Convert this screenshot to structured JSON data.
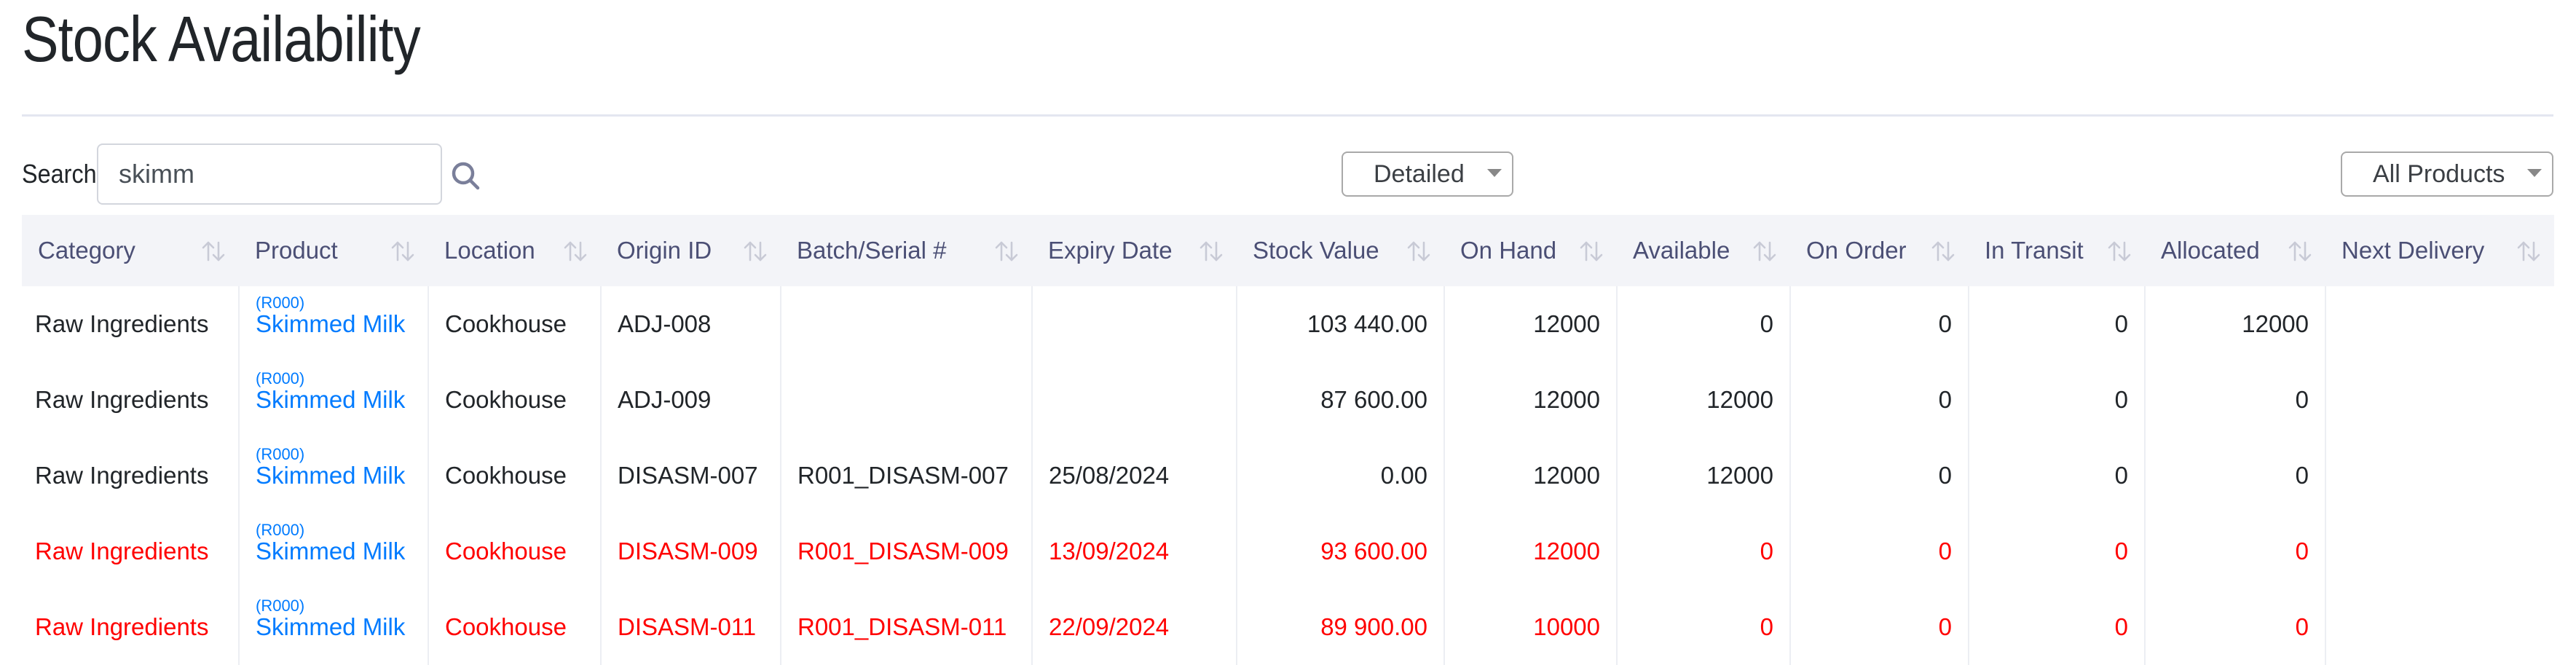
{
  "page": {
    "title": "Stock Availability"
  },
  "toolbar": {
    "search_label": "Search:",
    "search_value": "skimm",
    "search_icon": "search-icon",
    "view_select": {
      "selected": "Detailed"
    },
    "product_filter": {
      "selected": "All Products"
    }
  },
  "colors": {
    "link": "#007bff",
    "alert": "#ff0000",
    "header_bg": "#f3f4f8",
    "header_text": "#4b4f75"
  },
  "table": {
    "columns": [
      {
        "label": "Category",
        "sort_icon": "sort-icon"
      },
      {
        "label": "Product",
        "sort_icon": "sort-icon"
      },
      {
        "label": "Location",
        "sort_icon": "sort-icon"
      },
      {
        "label": "Origin ID",
        "sort_icon": "sort-icon"
      },
      {
        "label": "Batch/Serial #",
        "sort_icon": "sort-icon"
      },
      {
        "label": "Expiry Date",
        "sort_icon": "sort-icon"
      },
      {
        "label": "Stock Value",
        "sort_icon": "sort-icon"
      },
      {
        "label": "On Hand",
        "sort_icon": "sort-icon"
      },
      {
        "label": "Available",
        "sort_icon": "sort-icon"
      },
      {
        "label": "On Order",
        "sort_icon": "sort-icon"
      },
      {
        "label": "In Transit",
        "sort_icon": "sort-icon"
      },
      {
        "label": "Allocated",
        "sort_icon": "sort-icon"
      },
      {
        "label": "Next Delivery",
        "sort_icon": "sort-icon"
      }
    ],
    "rows": [
      {
        "alert": false,
        "category": "Raw Ingredients",
        "product_code": "(R000)",
        "product_name": "Skimmed Milk",
        "location": "Cookhouse",
        "origin_id": "ADJ-008",
        "batch": "",
        "expiry": "",
        "stock_value": "103 440.00",
        "on_hand": "12000",
        "available": "0",
        "on_order": "0",
        "in_transit": "0",
        "allocated": "12000",
        "next_delivery": ""
      },
      {
        "alert": false,
        "category": "Raw Ingredients",
        "product_code": "(R000)",
        "product_name": "Skimmed Milk",
        "location": "Cookhouse",
        "origin_id": "ADJ-009",
        "batch": "",
        "expiry": "",
        "stock_value": "87 600.00",
        "on_hand": "12000",
        "available": "12000",
        "on_order": "0",
        "in_transit": "0",
        "allocated": "0",
        "next_delivery": ""
      },
      {
        "alert": false,
        "category": "Raw Ingredients",
        "product_code": "(R000)",
        "product_name": "Skimmed Milk",
        "location": "Cookhouse",
        "origin_id": "DISASM-007",
        "batch": "R001_DISASM-007",
        "expiry": "25/08/2024",
        "stock_value": "0.00",
        "on_hand": "12000",
        "available": "12000",
        "on_order": "0",
        "in_transit": "0",
        "allocated": "0",
        "next_delivery": ""
      },
      {
        "alert": true,
        "category": "Raw Ingredients",
        "product_code": "(R000)",
        "product_name": "Skimmed Milk",
        "location": "Cookhouse",
        "origin_id": "DISASM-009",
        "batch": "R001_DISASM-009",
        "expiry": "13/09/2024",
        "stock_value": "93 600.00",
        "on_hand": "12000",
        "available": "0",
        "on_order": "0",
        "in_transit": "0",
        "allocated": "0",
        "next_delivery": ""
      },
      {
        "alert": true,
        "category": "Raw Ingredients",
        "product_code": "(R000)",
        "product_name": "Skimmed Milk",
        "location": "Cookhouse",
        "origin_id": "DISASM-011",
        "batch": "R001_DISASM-011",
        "expiry": "22/09/2024",
        "stock_value": "89 900.00",
        "on_hand": "10000",
        "available": "0",
        "on_order": "0",
        "in_transit": "0",
        "allocated": "0",
        "next_delivery": ""
      }
    ]
  }
}
